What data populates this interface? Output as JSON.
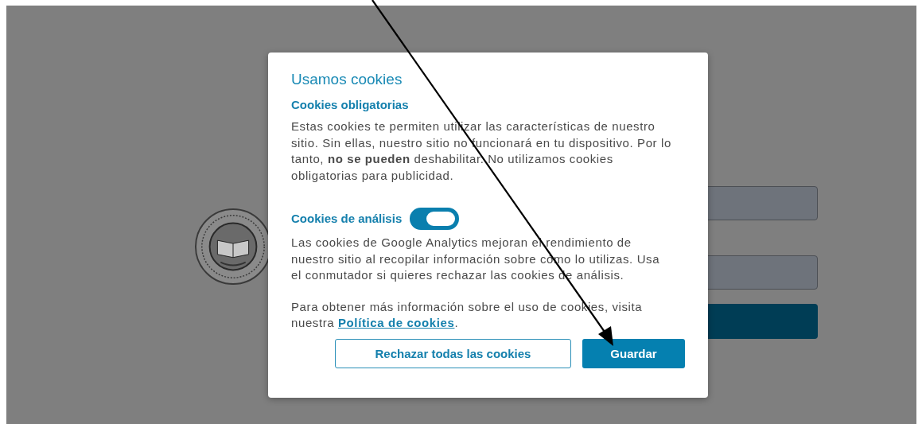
{
  "background_page": {
    "fields": [
      {
        "kind": "input"
      },
      {
        "kind": "input"
      }
    ],
    "submit": {
      "kind": "button"
    }
  },
  "cookie_dialog": {
    "title": "Usamos cookies",
    "sections": [
      {
        "kind": "plain",
        "heading": "Cookies obligatorias",
        "text": "Estas cookies te permiten utilizar las características de nuestro sitio. Sin ellas, nuestro sitio no funcionará en tu dispositivo. Por lo tanto, **no se pueden** deshabilitar. No utilizamos cookies obligatorias para publicidad."
      },
      {
        "kind": "toggle",
        "heading": "Cookies de análisis",
        "on": true,
        "text": "Las cookies de Google Analytics mejoran el rendimiento de nuestro sitio al recopilar información sobre cómo lo utilizas. Usa el conmutador si quieres rechazar las cookies de análisis."
      }
    ],
    "info": {
      "before": "Para obtener más información sobre el uso de cookies, visita nuestra ",
      "link": "Política de cookies",
      "after": "."
    },
    "buttons": [
      {
        "kind": "outline",
        "label": "Rechazar todas las cookies"
      },
      {
        "kind": "primary",
        "label": "Guardar"
      }
    ]
  }
}
